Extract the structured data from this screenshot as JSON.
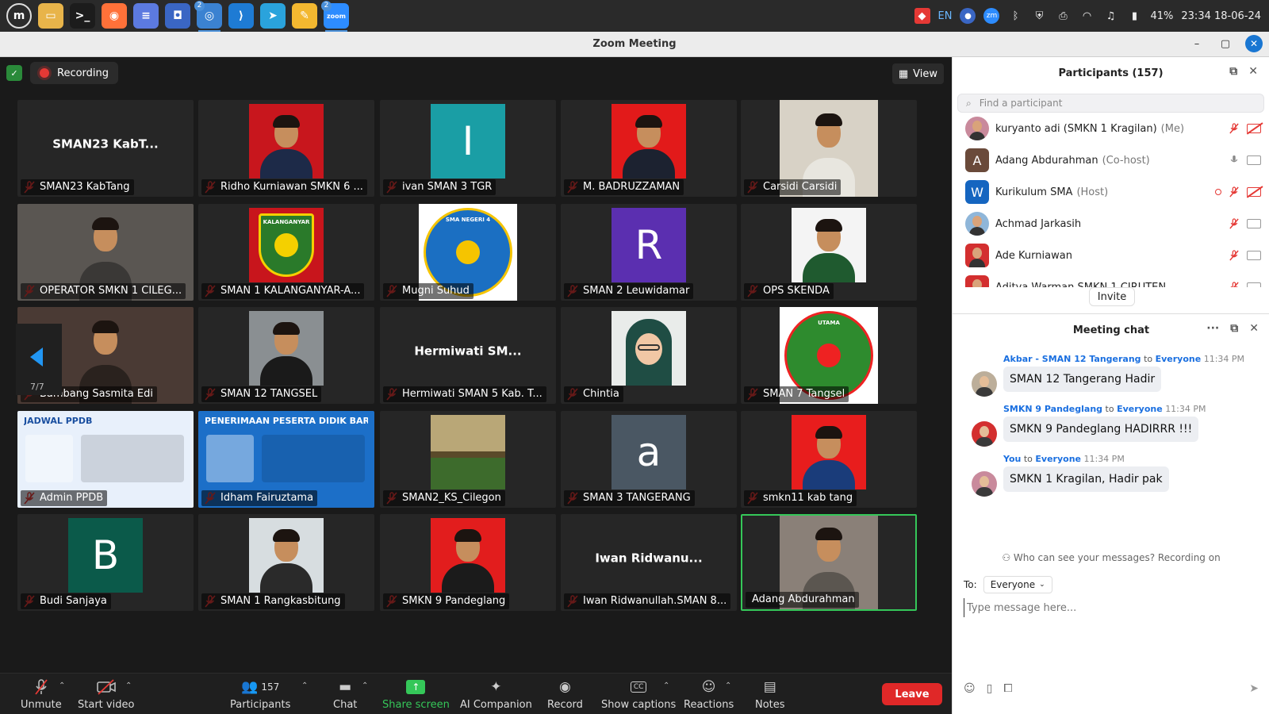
{
  "os": {
    "apps": [
      {
        "name": "mint-menu-icon",
        "color": "#2b2b2b",
        "glyph": "m"
      },
      {
        "name": "files-icon",
        "color": "#e8b44a",
        "glyph": "▭"
      },
      {
        "name": "terminal-icon",
        "color": "#1c1c1c",
        "glyph": ">_"
      },
      {
        "name": "browser-icon",
        "color": "#ff7139",
        "glyph": "◉"
      },
      {
        "name": "text-editor-icon",
        "color": "#5c7ae0",
        "glyph": "≡"
      },
      {
        "name": "screenshot-icon",
        "color": "#3a66c4",
        "glyph": "◘"
      },
      {
        "name": "chrome-icon",
        "color": "#3b82d1",
        "glyph": "◎",
        "badge": "2"
      },
      {
        "name": "vscode-icon",
        "color": "#1e7bd4",
        "glyph": "⟩"
      },
      {
        "name": "telegram-icon",
        "color": "#2aa3dc",
        "glyph": "➤"
      },
      {
        "name": "notes-icon",
        "color": "#f3b830",
        "glyph": "✎"
      },
      {
        "name": "zoom-app-icon",
        "color": "#2d8cff",
        "glyph": "zoom",
        "badge": "2"
      }
    ],
    "tray": {
      "lang": "EN",
      "battery": "41%",
      "clock": "23:34 18-06-24"
    }
  },
  "window": {
    "title": "Zoom Meeting"
  },
  "meeting": {
    "recording_label": "Recording",
    "view_label": "View",
    "page_indicator": "7/7",
    "tiles": [
      {
        "name": "SMAN23 KabTang",
        "kind": "text",
        "text": "SMAN23 KabT...",
        "muted": true
      },
      {
        "name": "Ridho Kurniawan SMKN 6 ...",
        "kind": "photo",
        "bg": "#c8161d",
        "suit": "#1d2a48",
        "muted": true
      },
      {
        "name": "ivan SMAN 3 TGR",
        "kind": "letter",
        "letter": "I",
        "bg": "#1a9ea5",
        "muted": true
      },
      {
        "name": "M. BADRUZZAMAN",
        "kind": "photo",
        "bg": "#e21a1a",
        "suit": "#1c2230",
        "muted": true
      },
      {
        "name": "Carsidi Carsidi",
        "kind": "photo",
        "bg": "#d8d2c6",
        "suit": "#e8e6df",
        "muted": true,
        "wide": true
      },
      {
        "name": "OPERATOR SMKN 1 CILEG...",
        "kind": "photo",
        "bg": "#5a5652",
        "suit": "#3a3836",
        "muted": true,
        "full": true
      },
      {
        "name": "SMAN 1 KALANGANYAR-A...",
        "kind": "logo",
        "bg": "#c8151c",
        "accent": "#f4d000",
        "logo_text": "KALANGANYAR",
        "muted": true
      },
      {
        "name": "Mugni Suhud",
        "kind": "logo",
        "bg": "#1b6fc2",
        "accent": "#f5c400",
        "logo_text": "SMA NEGERI 4",
        "muted": true,
        "round": true
      },
      {
        "name": "SMAN 2 Leuwidamar",
        "kind": "letter",
        "letter": "R",
        "bg": "#5b2fb0",
        "muted": true
      },
      {
        "name": "OPS SKENDA",
        "kind": "photo",
        "bg": "#f4f4f4",
        "suit": "#1f5a2f",
        "muted": true
      },
      {
        "name": "Bambang Sasmita Edi",
        "kind": "photo",
        "bg": "#4a3a34",
        "suit": "#2a221e",
        "muted": true,
        "full": true
      },
      {
        "name": "SMAN 12 TANGSEL",
        "kind": "photo",
        "bg": "#8a8f92",
        "suit": "#1a1a1a",
        "muted": true
      },
      {
        "name": "Hermiwati SMAN 5 Kab. T...",
        "kind": "text",
        "text": "Hermiwati SM...",
        "muted": true
      },
      {
        "name": "Chintia",
        "kind": "avatar",
        "bg": "#e9ecea",
        "suit": "#1f4d44",
        "muted": true
      },
      {
        "name": "SMAN 7 Tangsel",
        "kind": "logo",
        "bg": "#2e8b2e",
        "accent": "#e22",
        "logo_text": "UTAMA",
        "muted": true,
        "round": true
      },
      {
        "name": "Admin PPDB",
        "kind": "poster",
        "bg": "#e8f0fb",
        "accent": "#1a4fa0",
        "poster_text": "JADWAL PPDB",
        "muted": true,
        "full": true
      },
      {
        "name": "Idham Fairuztama",
        "kind": "poster",
        "bg": "#1c6fc8",
        "accent": "#ffffff",
        "poster_text": "PENERIMAAN PESERTA DIDIK BARU",
        "muted": true,
        "full": true
      },
      {
        "name": "SMAN2_KS_Cilegon",
        "kind": "photo",
        "bg": "#b9a777",
        "suit": "#3d6b2c",
        "muted": true,
        "landscape": true
      },
      {
        "name": "SMAN 3 TANGERANG",
        "kind": "letter",
        "letter": "a",
        "bg": "#4a5763",
        "muted": true
      },
      {
        "name": "smkn11 kab tang",
        "kind": "photo",
        "bg": "#e81d1d",
        "suit": "#1a3c7a",
        "muted": true
      },
      {
        "name": "Budi Sanjaya",
        "kind": "letter",
        "letter": "B",
        "bg": "#0b5a4a",
        "muted": true
      },
      {
        "name": "SMAN 1 Rangkasbitung",
        "kind": "photo",
        "bg": "#d7dde0",
        "suit": "#2a2a2a",
        "muted": true
      },
      {
        "name": "SMKN 9 Pandeglang",
        "kind": "photo",
        "bg": "#e21d1d",
        "suit": "#1b1b1b",
        "muted": true
      },
      {
        "name": "Iwan Ridwanullah.SMAN 8...",
        "kind": "text",
        "text": "Iwan Ridwanu...",
        "muted": true
      },
      {
        "name": "Adang Abdurahman",
        "kind": "photo",
        "bg": "#8a8078",
        "suit": "#5b5650",
        "muted": false,
        "active": true,
        "wide": true
      }
    ]
  },
  "toolbar": {
    "unmute": "Unmute",
    "start_video": "Start video",
    "participants": "Participants",
    "participant_count": "157",
    "chat": "Chat",
    "share_screen": "Share screen",
    "ai_companion": "AI Companion",
    "record": "Record",
    "show_captions": "Show captions",
    "reactions": "Reactions",
    "notes": "Notes",
    "leave": "Leave"
  },
  "participants_panel": {
    "title": "Participants (157)",
    "search_placeholder": "Find a participant",
    "invite": "Invite",
    "list": [
      {
        "name": "kuryanto adi (SMKN 1 Kragilan)",
        "role": "(Me)",
        "av_bg": "#c98a9c",
        "av_letter": "",
        "mic_muted": true,
        "video_off": true
      },
      {
        "name": "Adang Abdurahman",
        "role": "(Co-host)",
        "av_bg": "#6a4a3a",
        "av_letter": "A",
        "mic_muted": false,
        "video_off": false
      },
      {
        "name": "Kurikulum SMA",
        "role": "(Host)",
        "av_bg": "#1565c0",
        "av_letter": "W",
        "mic_muted": true,
        "video_off": true,
        "recording": true
      },
      {
        "name": "Achmad Jarkasih",
        "role": "",
        "av_bg": "#8fb6d9",
        "av_letter": "",
        "mic_muted": true,
        "video_off": false
      },
      {
        "name": "Ade Kurniawan",
        "role": "",
        "av_bg": "#d32f2f",
        "av_letter": "",
        "mic_muted": true,
        "video_off": false
      },
      {
        "name": "Aditya Warman SMKN 1 CIRUTEN",
        "role": "",
        "av_bg": "#d32f2f",
        "av_letter": "",
        "mic_muted": true,
        "video_off": false
      }
    ]
  },
  "chat_panel": {
    "title": "Meeting chat",
    "messages": [
      {
        "from": "Akbar - SMAN 12 Tangerang",
        "to_word": "to",
        "to": "Everyone",
        "time": "11:34 PM",
        "text": "SMAN 12 Tangerang Hadir",
        "av_bg": "#bcae9a"
      },
      {
        "from": "SMKN 9 Pandeglang",
        "to_word": "to",
        "to": "Everyone",
        "time": "11:34 PM",
        "text": "SMKN 9 Pandeglang HADIRRR !!!",
        "av_bg": "#d32f2f"
      },
      {
        "from": "You",
        "to_word": "to",
        "to": "Everyone",
        "time": "11:34 PM",
        "text": "SMKN 1 Kragilan, Hadir pak",
        "av_bg": "#c98a9c"
      }
    ],
    "privacy_note": "Who can see your messages? Recording on",
    "to_label": "To:",
    "to_value": "Everyone",
    "input_placeholder": "Type message here..."
  }
}
